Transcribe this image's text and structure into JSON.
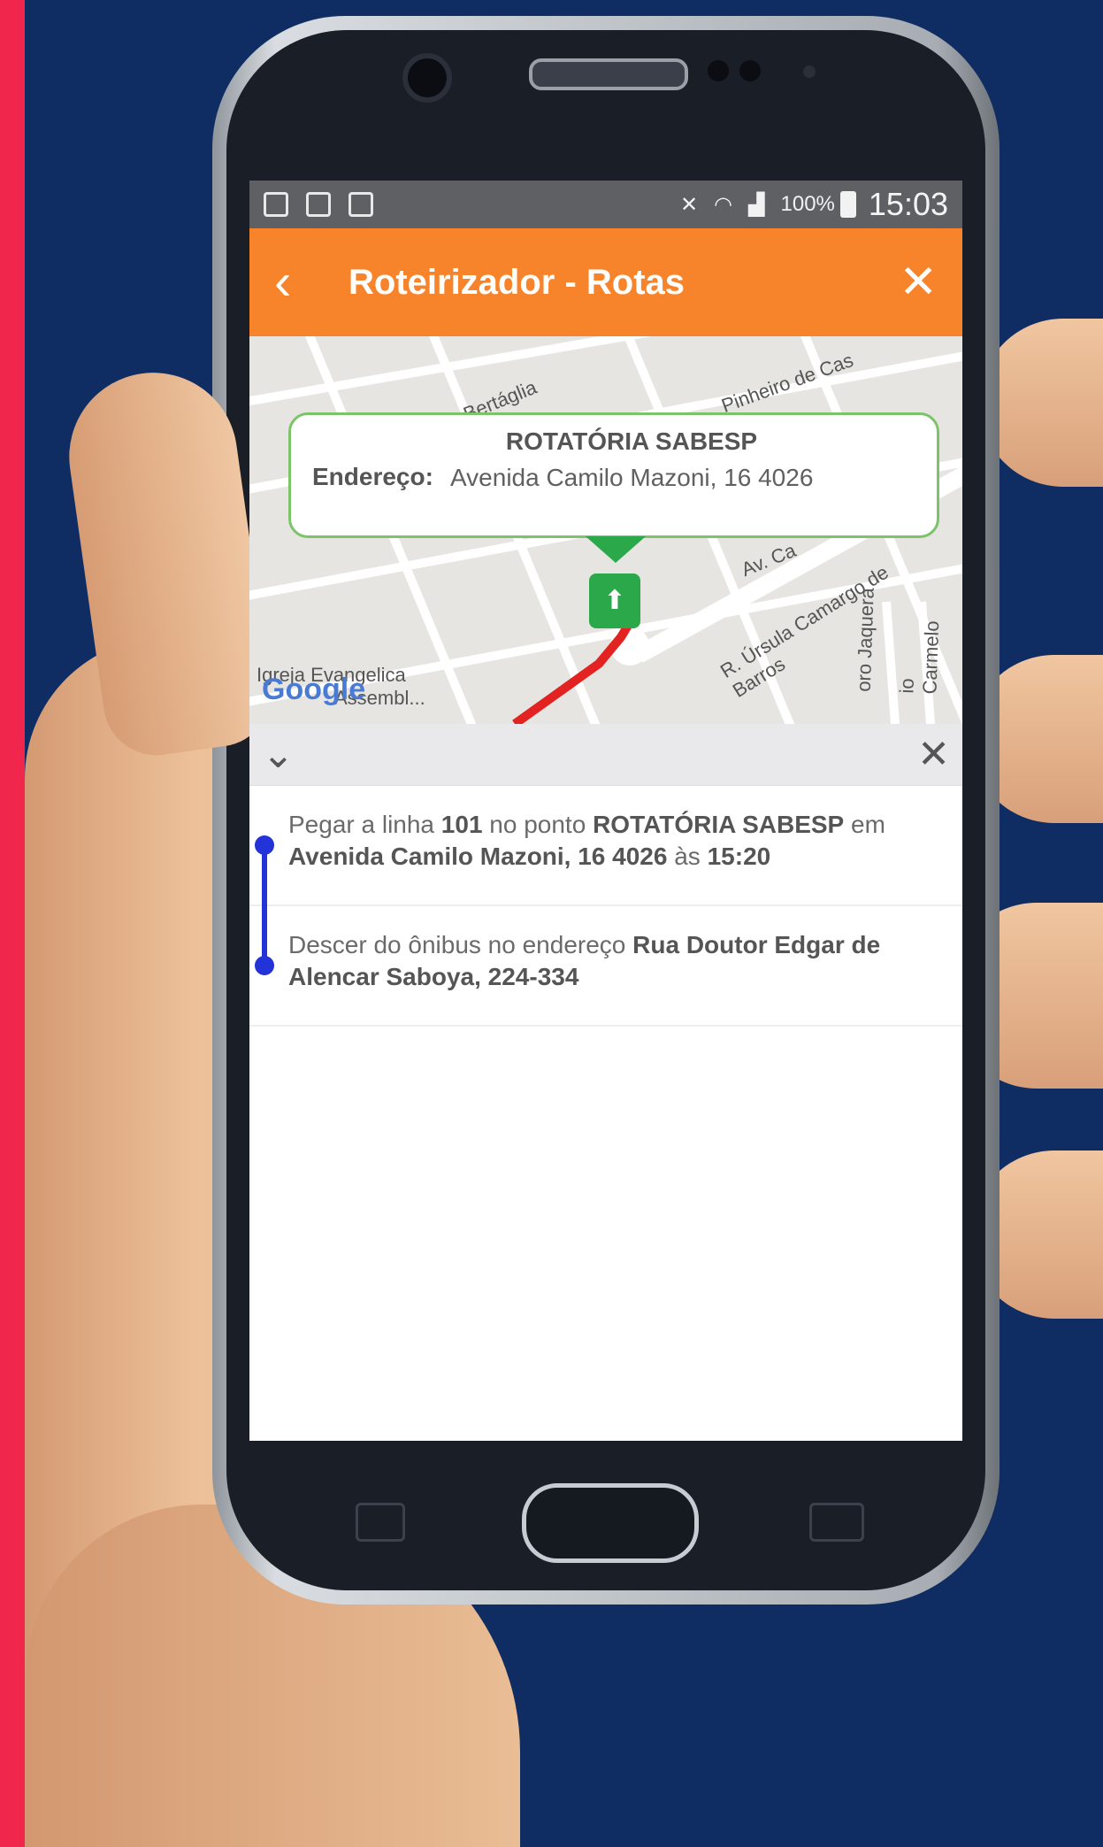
{
  "app": {
    "title": "Roteirizador - Rotas",
    "back_icon": "chevron-left-icon",
    "close_icon": "close-icon"
  },
  "status_bar": {
    "battery": "100%",
    "time": "15:03"
  },
  "map": {
    "card_name": "ROTATÓRIA SABESP",
    "card_label": "Endereço:",
    "card_address": "Avenida Camilo Mazoni, 16 4026",
    "attribution": "Google",
    "street_labels": [
      "Bertáglia",
      "Pinheiro de Cas",
      "Av. Ca",
      "R. Úrsula Camargo de Barros",
      "oro Jaquera",
      "io Carmelo",
      "Igreja Evangelica",
      "Assembl..."
    ]
  },
  "steps": [
    {
      "t1": "Pegar a linha ",
      "line": "101",
      "t2": " no ponto ",
      "stop": "ROTATÓRIA SABESP",
      "t3": " em ",
      "address": "Avenida Camilo Mazoni, 16 4026",
      "t4": " às ",
      "time": "15:20"
    },
    {
      "t1": "Descer do ônibus no endereço ",
      "address": "Rua Doutor Edgar de Alencar Saboya, 224-334"
    }
  ],
  "colors": {
    "app_bar": "#f7832a",
    "route_line": "#e32222",
    "timeline": "#2233d8",
    "marker": "#2aa84a"
  }
}
